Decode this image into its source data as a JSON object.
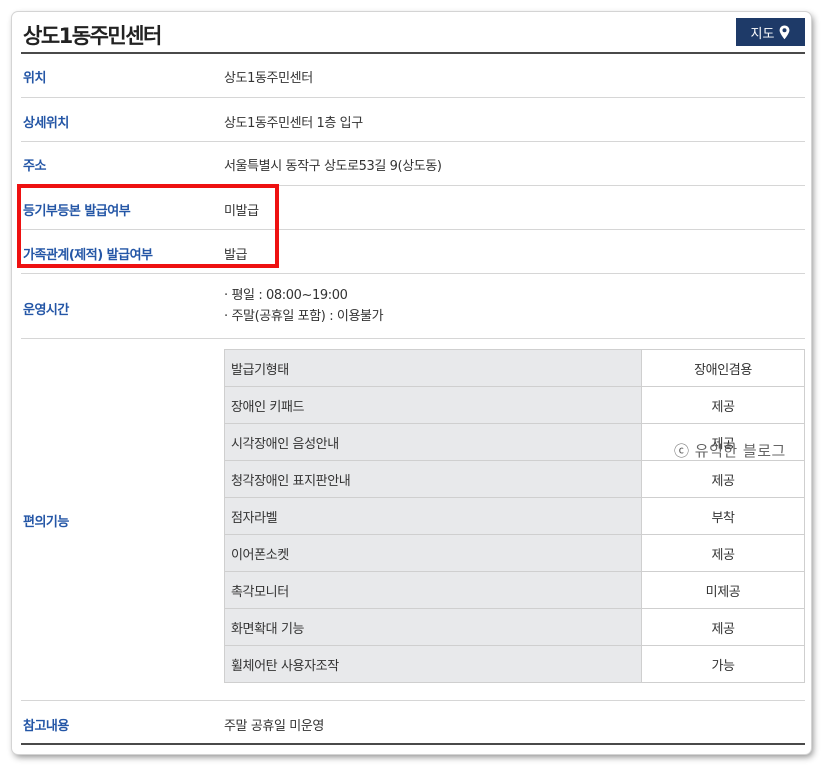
{
  "header": {
    "title": "상도1동주민센터",
    "map_button": "지도",
    "map_icon": "location-pin-icon"
  },
  "rows": {
    "location": {
      "label": "위치",
      "value": "상도1동주민센터"
    },
    "detail_location": {
      "label": "상세위치",
      "value": "상도1동주민센터 1층 입구"
    },
    "address": {
      "label": "주소",
      "value": "서울특별시 동작구 상도로53길 9(상도동)"
    },
    "registry_issuance": {
      "label": "등기부등본 발급여부",
      "value": "미발급"
    },
    "family_issuance": {
      "label": "가족관계(제적) 발급여부",
      "value": "발급"
    },
    "hours": {
      "label": "운영시간",
      "lines": [
        "· 평일 : 08:00~19:00",
        "· 주말(공휴일 포함) : 이용불가"
      ]
    },
    "convenience": {
      "label": "편의기능",
      "items": [
        {
          "feature": "발급기형태",
          "status": "장애인겸용"
        },
        {
          "feature": "장애인 키패드",
          "status": "제공"
        },
        {
          "feature": "시각장애인 음성안내",
          "status": "제공"
        },
        {
          "feature": "청각장애인 표지판안내",
          "status": "제공"
        },
        {
          "feature": "점자라벨",
          "status": "부착"
        },
        {
          "feature": "이어폰소켓",
          "status": "제공"
        },
        {
          "feature": "촉각모니터",
          "status": "미제공"
        },
        {
          "feature": "화면확대 기능",
          "status": "제공"
        },
        {
          "feature": "휠체어탄 사용자조작",
          "status": "가능"
        }
      ]
    },
    "notes": {
      "label": "참고내용",
      "value": "주말 공휴일 미운영"
    }
  },
  "watermark": "ⓒ 유익한 블로그",
  "colors": {
    "label": "#2456a6",
    "map_button_bg": "#1e3a68",
    "highlight_border": "#ee1111",
    "feature_cell_bg": "#e8e9eb"
  }
}
